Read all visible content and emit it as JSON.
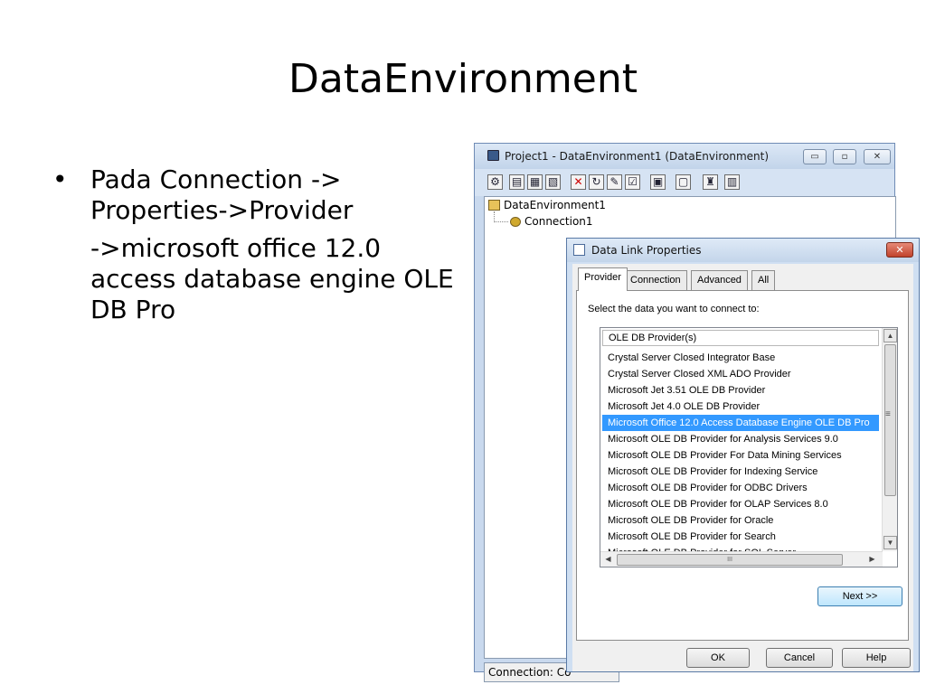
{
  "slide": {
    "title": "DataEnvironment",
    "bullet_symbol": "•",
    "bullet_line1": "Pada Connection ->",
    "bullet_line2": "Properties->Provider",
    "bullet_sub": "->microsoft office 12.0 access database engine OLE DB Pro"
  },
  "de_window": {
    "title": "Project1 - DataEnvironment1 (DataEnvironment)",
    "minimize_label": "▭",
    "maximize_label": "▫",
    "close_label": "✕",
    "tree_root": "DataEnvironment1",
    "tree_child": "Connection1",
    "status": "Connection: Co"
  },
  "dialog": {
    "title": "Data Link Properties",
    "close_label": "✕",
    "tabs": [
      "Provider",
      "Connection",
      "Advanced",
      "All"
    ],
    "select_label": "Select the data you want to connect to:",
    "list_header": "OLE DB Provider(s)",
    "providers": [
      "Crystal Server Closed Integrator Base",
      "Crystal Server Closed XML ADO Provider",
      "Microsoft Jet 3.51 OLE DB Provider",
      "Microsoft Jet 4.0 OLE DB Provider",
      "Microsoft Office 12.0 Access Database Engine OLE DB Pro",
      "Microsoft OLE DB Provider for Analysis Services 9.0",
      "Microsoft OLE DB Provider For Data Mining Services",
      "Microsoft OLE DB Provider for Indexing Service",
      "Microsoft OLE DB Provider for ODBC Drivers",
      "Microsoft OLE DB Provider for OLAP Services 8.0",
      "Microsoft OLE DB Provider for Oracle",
      "Microsoft OLE DB Provider for Search",
      "Microsoft OLE DB Provider for SQL Server"
    ],
    "selected_provider": "Microsoft Office 12.0 Access Database Engine OLE DB Pro",
    "scroll_up": "▲",
    "scroll_down": "▼",
    "scroll_left": "◀",
    "scroll_right": "▶",
    "scroll_grip": "III",
    "scroll_mid": "≡",
    "next_label": "Next >>",
    "ok_label": "OK",
    "cancel_label": "Cancel",
    "help_label": "Help"
  },
  "colors": {
    "selection": "#3399ff",
    "title_gradient_top": "#dfeaf7",
    "close_red": "#c1432c"
  }
}
